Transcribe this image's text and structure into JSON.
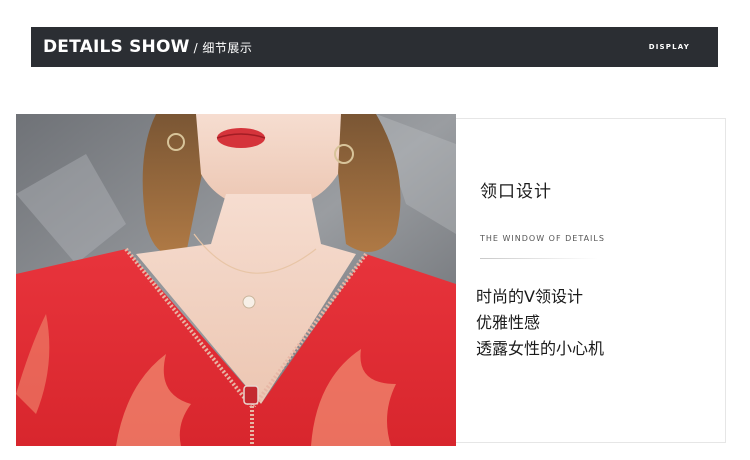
{
  "banner": {
    "title": "DETAILS SHOW",
    "subtitle": "/ 细节展示",
    "right_label": "DISPLAY",
    "background": "#2b2e33"
  },
  "photo": {
    "description_icon": "model-photo"
  },
  "detail_card": {
    "title": "领口设计",
    "subtitle": "THE WINDOW OF DETAILS",
    "lines": [
      "时尚的V领设计",
      "优雅性感",
      "透露女性的小心机"
    ]
  }
}
